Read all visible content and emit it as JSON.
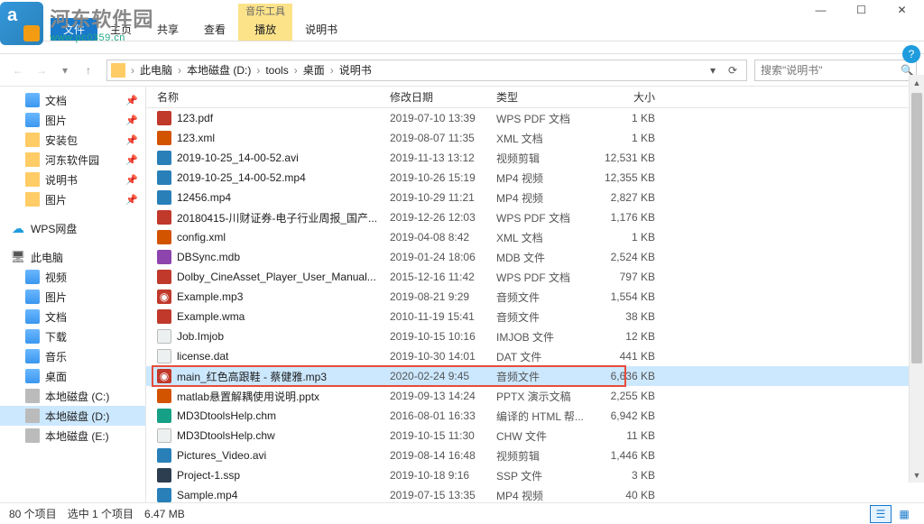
{
  "watermark": {
    "line1": "河东软件园",
    "line2": "www.pc0359.cn"
  },
  "window": {
    "min": "—",
    "max": "☐",
    "close": "✕"
  },
  "ribbon": {
    "file": "文件",
    "tabs": [
      "主页",
      "共享",
      "查看"
    ],
    "context_group_label": "音乐工具",
    "context_tab": "播放",
    "extra_tab": "说明书"
  },
  "nav": {
    "back": "←",
    "fwd": "→",
    "up": "↑",
    "dropdown": "▾",
    "refresh": "⟳"
  },
  "breadcrumb": [
    "此电脑",
    "本地磁盘 (D:)",
    "tools",
    "桌面",
    "说明书"
  ],
  "search": {
    "placeholder": "搜索\"说明书\"",
    "icon": "🔍"
  },
  "sidebar": {
    "quick": [
      {
        "name": "文档",
        "icon": "ic-doc",
        "pinned": true
      },
      {
        "name": "图片",
        "icon": "ic-pic",
        "pinned": true
      },
      {
        "name": "安装包",
        "icon": "ic-folder",
        "pinned": true
      },
      {
        "name": "河东软件园",
        "icon": "ic-folder",
        "pinned": true
      },
      {
        "name": "说明书",
        "icon": "ic-folder",
        "pinned": true
      },
      {
        "name": "图片",
        "icon": "ic-folder",
        "pinned": true
      }
    ],
    "wps": "WPS网盘",
    "pc": "此电脑",
    "pc_items": [
      {
        "name": "视频",
        "icon": "ic-vid"
      },
      {
        "name": "图片",
        "icon": "ic-pic"
      },
      {
        "name": "文档",
        "icon": "ic-doc"
      },
      {
        "name": "下载",
        "icon": "ic-dl"
      },
      {
        "name": "音乐",
        "icon": "ic-music"
      },
      {
        "name": "桌面",
        "icon": "ic-desk"
      },
      {
        "name": "本地磁盘 (C:)",
        "icon": "ic-drive"
      },
      {
        "name": "本地磁盘 (D:)",
        "icon": "ic-drive",
        "selected": true
      },
      {
        "name": "本地磁盘 (E:)",
        "icon": "ic-drive"
      }
    ]
  },
  "columns": {
    "name": "名称",
    "date": "修改日期",
    "type": "类型",
    "size": "大小"
  },
  "files": [
    {
      "name": "123.pdf",
      "date": "2019-07-10 13:39",
      "type": "WPS PDF 文档",
      "size": "1 KB",
      "icon": "fi-pdf"
    },
    {
      "name": "123.xml",
      "date": "2019-08-07 11:35",
      "type": "XML 文档",
      "size": "1 KB",
      "icon": "fi-xml"
    },
    {
      "name": "2019-10-25_14-00-52.avi",
      "date": "2019-11-13 13:12",
      "type": "视频剪辑",
      "size": "12,531 KB",
      "icon": "fi-avi"
    },
    {
      "name": "2019-10-25_14-00-52.mp4",
      "date": "2019-10-26 15:19",
      "type": "MP4 视频",
      "size": "12,355 KB",
      "icon": "fi-mp4"
    },
    {
      "name": "12456.mp4",
      "date": "2019-10-29 11:21",
      "type": "MP4 视频",
      "size": "2,827 KB",
      "icon": "fi-mp4"
    },
    {
      "name": "20180415-川财证券-电子行业周报_国产...",
      "date": "2019-12-26 12:03",
      "type": "WPS PDF 文档",
      "size": "1,176 KB",
      "icon": "fi-pdf"
    },
    {
      "name": "config.xml",
      "date": "2019-04-08 8:42",
      "type": "XML 文档",
      "size": "1 KB",
      "icon": "fi-xml"
    },
    {
      "name": "DBSync.mdb",
      "date": "2019-01-24 18:06",
      "type": "MDB 文件",
      "size": "2,524 KB",
      "icon": "fi-mdb"
    },
    {
      "name": "Dolby_CineAsset_Player_User_Manual...",
      "date": "2015-12-16 11:42",
      "type": "WPS PDF 文档",
      "size": "797 KB",
      "icon": "fi-pdf"
    },
    {
      "name": "Example.mp3",
      "date": "2019-08-21 9:29",
      "type": "音频文件",
      "size": "1,554 KB",
      "icon": "fi-mp3"
    },
    {
      "name": "Example.wma",
      "date": "2010-11-19 15:41",
      "type": "音频文件",
      "size": "38 KB",
      "icon": "fi-wma"
    },
    {
      "name": "Job.Imjob",
      "date": "2019-10-15 10:16",
      "type": "IMJOB 文件",
      "size": "12 KB",
      "icon": "fi-txt"
    },
    {
      "name": "license.dat",
      "date": "2019-10-30 14:01",
      "type": "DAT 文件",
      "size": "441 KB",
      "icon": "fi-dat"
    },
    {
      "name": "main_红色高跟鞋 - 蔡健雅.mp3",
      "date": "2020-02-24 9:45",
      "type": "音频文件",
      "size": "6,636 KB",
      "icon": "fi-mp3",
      "selected": true,
      "highlighted": true
    },
    {
      "name": "matlab悬置解耦使用说明.pptx",
      "date": "2019-09-13 14:24",
      "type": "PPTX 演示文稿",
      "size": "2,255 KB",
      "icon": "fi-pptx"
    },
    {
      "name": "MD3DtoolsHelp.chm",
      "date": "2016-08-01 16:33",
      "type": "编译的 HTML 帮...",
      "size": "6,942 KB",
      "icon": "fi-chm"
    },
    {
      "name": "MD3DtoolsHelp.chw",
      "date": "2019-10-15 11:30",
      "type": "CHW 文件",
      "size": "11 KB",
      "icon": "fi-chw"
    },
    {
      "name": "Pictures_Video.avi",
      "date": "2019-08-14 16:48",
      "type": "视频剪辑",
      "size": "1,446 KB",
      "icon": "fi-avi"
    },
    {
      "name": "Project-1.ssp",
      "date": "2019-10-18 9:16",
      "type": "SSP 文件",
      "size": "3 KB",
      "icon": "fi-ssp"
    },
    {
      "name": "Sample.mp4",
      "date": "2019-07-15 13:35",
      "type": "MP4 视频",
      "size": "40 KB",
      "icon": "fi-mp4"
    }
  ],
  "status": {
    "count": "80 个项目",
    "selected": "选中 1 个项目",
    "size": "6.47 MB"
  }
}
